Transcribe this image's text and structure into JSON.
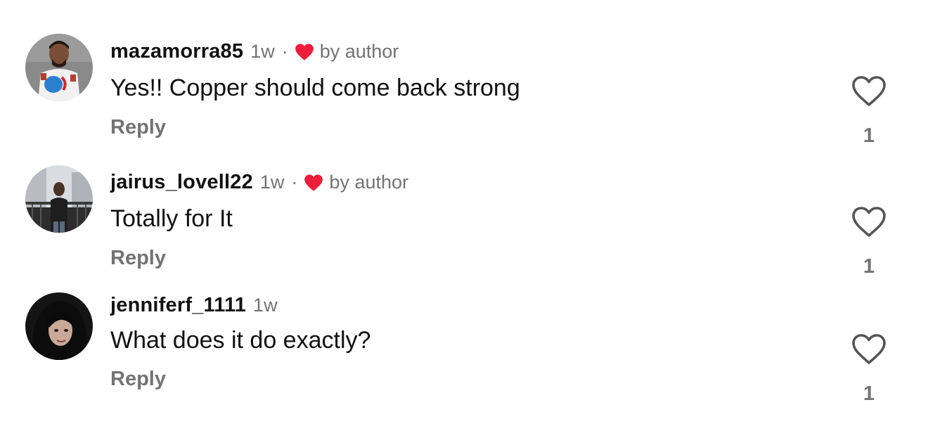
{
  "comments": [
    {
      "username": "mazamorra85",
      "time": "1w",
      "separator": "·",
      "liked_by_author": true,
      "liked_by_author_icon": "red-heart-icon",
      "by_author_label": "by author",
      "text": "Yes!! Copper should come back strong",
      "reply_label": "Reply",
      "like_icon": "heart-outline-icon",
      "like_count": "1"
    },
    {
      "username": "jairus_lovell22",
      "time": "1w",
      "separator": "·",
      "liked_by_author": true,
      "liked_by_author_icon": "red-heart-icon",
      "by_author_label": "by author",
      "text": "Totally for It",
      "reply_label": "Reply",
      "like_icon": "heart-outline-icon",
      "like_count": "1"
    },
    {
      "username": "jenniferf_1111",
      "time": "1w",
      "liked_by_author": false,
      "text": "What does it do exactly?",
      "reply_label": "Reply",
      "like_icon": "heart-outline-icon",
      "like_count": "1"
    }
  ],
  "colors": {
    "primary_text": "#111111",
    "secondary_text": "#737373",
    "author_heart": "#ee1d3a",
    "like_outline": "#555555"
  }
}
